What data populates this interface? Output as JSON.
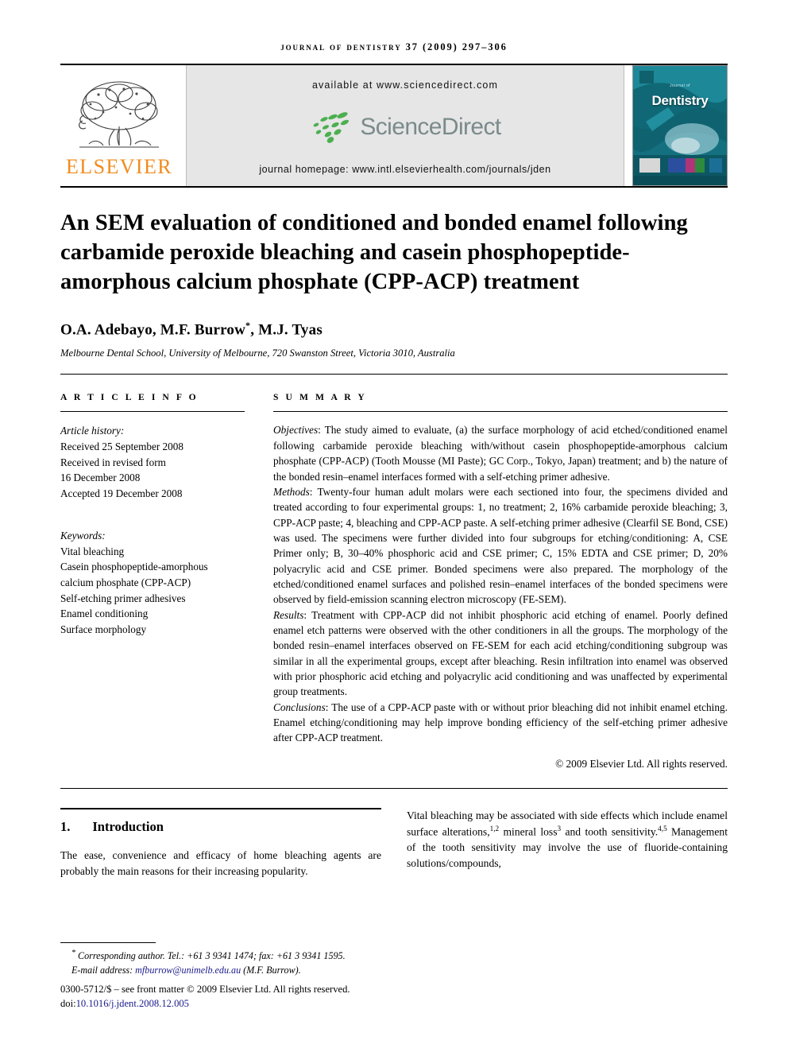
{
  "running_head": "Journal of Dentistry 37 (2009) 297–306",
  "masthead": {
    "publisher_wordmark": "ELSEVIER",
    "sciencedirect": {
      "available_at": "available at www.sciencedirect.com",
      "wordmark": "ScienceDirect",
      "journal_homepage": "journal homepage: www.intl.elsevierhealth.com/journals/jden"
    },
    "cover": {
      "superline": "Journal of",
      "title": "Dentistry"
    }
  },
  "article": {
    "title": "An SEM evaluation of conditioned and bonded enamel following carbamide peroxide bleaching and casein phosphopeptide-amorphous calcium phosphate (CPP-ACP) treatment",
    "authors": "O.A. Adebayo, M.F. Burrow",
    "authors_tail": ", M.J. Tyas",
    "corresponding_marker": "*",
    "affiliation": "Melbourne Dental School, University of Melbourne, 720 Swanston Street, Victoria 3010, Australia"
  },
  "article_info": {
    "heading": "A R T I C L E   I N F O",
    "history_label": "Article history:",
    "history": [
      "Received 25 September 2008",
      "Received in revised form",
      "16 December 2008",
      "Accepted 19 December 2008"
    ],
    "keywords_label": "Keywords:",
    "keywords": [
      "Vital bleaching",
      "Casein phosphopeptide-amorphous",
      "calcium phosphate (CPP-ACP)",
      "Self-etching primer adhesives",
      "Enamel conditioning",
      "Surface morphology"
    ]
  },
  "summary": {
    "heading": "S U M M A R Y",
    "objectives_label": "Objectives",
    "objectives_text": ": The study aimed to evaluate, (a) the surface morphology of acid etched/conditioned enamel following carbamide peroxide bleaching with/without casein phosphopeptide-amorphous calcium phosphate (CPP-ACP) (Tooth Mousse (MI Paste); GC Corp., Tokyo, Japan) treatment; and b) the nature of the bonded resin–enamel interfaces formed with a self-etching primer adhesive.",
    "methods_label": "Methods",
    "methods_text": ": Twenty-four human adult molars were each sectioned into four, the specimens divided and treated according to four experimental groups: 1, no treatment; 2, 16% carbamide peroxide bleaching; 3, CPP-ACP paste; 4, bleaching and CPP-ACP paste. A self-etching primer adhesive (Clearfil SE Bond, CSE) was used. The specimens were further divided into four subgroups for etching/conditioning: A, CSE Primer only; B, 30–40% phosphoric acid and CSE primer; C, 15% EDTA and CSE primer; D, 20% polyacrylic acid and CSE primer. Bonded specimens were also prepared. The morphology of the etched/conditioned enamel surfaces and polished resin–enamel interfaces of the bonded specimens were observed by field-emission scanning electron microscopy (FE-SEM).",
    "results_label": "Results",
    "results_text": ": Treatment with CPP-ACP did not inhibit phosphoric acid etching of enamel. Poorly defined enamel etch patterns were observed with the other conditioners in all the groups. The morphology of the bonded resin–enamel interfaces observed on FE-SEM for each acid etching/conditioning subgroup was similar in all the experimental groups, except after bleaching. Resin infiltration into enamel was observed with prior phosphoric acid etching and polyacrylic acid conditioning and was unaffected by experimental group treatments.",
    "conclusions_label": "Conclusions",
    "conclusions_text": ": The use of a CPP-ACP paste with or without prior bleaching did not inhibit enamel etching. Enamel etching/conditioning may help improve bonding efficiency of the self-etching primer adhesive after CPP-ACP treatment.",
    "copyright": "© 2009 Elsevier Ltd. All rights reserved."
  },
  "body": {
    "section_number": "1.",
    "section_title": "Introduction",
    "left_paragraph": "The ease, convenience and efficacy of home bleaching agents are probably the main reasons for their increasing popularity.",
    "right_paragraph_1": "Vital bleaching may be associated with side effects which include enamel surface alterations,",
    "right_cite_1": "1,2",
    "right_paragraph_2": " mineral loss",
    "right_cite_2": "3",
    "right_paragraph_3": " and tooth sensitivity.",
    "right_cite_3": "4,5",
    "right_paragraph_4": " Management of the tooth sensitivity may involve the use of fluoride-containing solutions/compounds,"
  },
  "footer": {
    "corr_marker": "*",
    "corr_text": " Corresponding author. Tel.: +61 3 9341 1474; fax: +61 3 9341 1595.",
    "email_label": "E-mail address: ",
    "email": "mfburrow@unimelb.edu.au",
    "email_tail": " (M.F. Burrow).",
    "front_matter": "0300-5712/$ – see front matter © 2009 Elsevier Ltd. All rights reserved.",
    "doi_label": "doi:",
    "doi": "10.1016/j.jdent.2008.12.005"
  },
  "colors": {
    "elsevier_orange": "#F08C1E",
    "sciencedirect_green": "#4CAF50",
    "sciencedirect_gray": "#7b8a8b",
    "link_blue": "#1a1a8c",
    "cover_teal": "#1d7f8c"
  }
}
